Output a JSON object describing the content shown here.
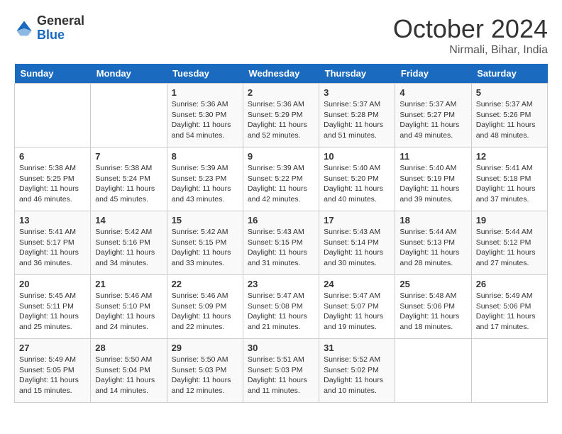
{
  "logo": {
    "general": "General",
    "blue": "Blue"
  },
  "title": "October 2024",
  "location": "Nirmali, Bihar, India",
  "days_header": [
    "Sunday",
    "Monday",
    "Tuesday",
    "Wednesday",
    "Thursday",
    "Friday",
    "Saturday"
  ],
  "weeks": [
    [
      {
        "num": "",
        "sunrise": "",
        "sunset": "",
        "daylight": ""
      },
      {
        "num": "",
        "sunrise": "",
        "sunset": "",
        "daylight": ""
      },
      {
        "num": "1",
        "sunrise": "Sunrise: 5:36 AM",
        "sunset": "Sunset: 5:30 PM",
        "daylight": "Daylight: 11 hours and 54 minutes."
      },
      {
        "num": "2",
        "sunrise": "Sunrise: 5:36 AM",
        "sunset": "Sunset: 5:29 PM",
        "daylight": "Daylight: 11 hours and 52 minutes."
      },
      {
        "num": "3",
        "sunrise": "Sunrise: 5:37 AM",
        "sunset": "Sunset: 5:28 PM",
        "daylight": "Daylight: 11 hours and 51 minutes."
      },
      {
        "num": "4",
        "sunrise": "Sunrise: 5:37 AM",
        "sunset": "Sunset: 5:27 PM",
        "daylight": "Daylight: 11 hours and 49 minutes."
      },
      {
        "num": "5",
        "sunrise": "Sunrise: 5:37 AM",
        "sunset": "Sunset: 5:26 PM",
        "daylight": "Daylight: 11 hours and 48 minutes."
      }
    ],
    [
      {
        "num": "6",
        "sunrise": "Sunrise: 5:38 AM",
        "sunset": "Sunset: 5:25 PM",
        "daylight": "Daylight: 11 hours and 46 minutes."
      },
      {
        "num": "7",
        "sunrise": "Sunrise: 5:38 AM",
        "sunset": "Sunset: 5:24 PM",
        "daylight": "Daylight: 11 hours and 45 minutes."
      },
      {
        "num": "8",
        "sunrise": "Sunrise: 5:39 AM",
        "sunset": "Sunset: 5:23 PM",
        "daylight": "Daylight: 11 hours and 43 minutes."
      },
      {
        "num": "9",
        "sunrise": "Sunrise: 5:39 AM",
        "sunset": "Sunset: 5:22 PM",
        "daylight": "Daylight: 11 hours and 42 minutes."
      },
      {
        "num": "10",
        "sunrise": "Sunrise: 5:40 AM",
        "sunset": "Sunset: 5:20 PM",
        "daylight": "Daylight: 11 hours and 40 minutes."
      },
      {
        "num": "11",
        "sunrise": "Sunrise: 5:40 AM",
        "sunset": "Sunset: 5:19 PM",
        "daylight": "Daylight: 11 hours and 39 minutes."
      },
      {
        "num": "12",
        "sunrise": "Sunrise: 5:41 AM",
        "sunset": "Sunset: 5:18 PM",
        "daylight": "Daylight: 11 hours and 37 minutes."
      }
    ],
    [
      {
        "num": "13",
        "sunrise": "Sunrise: 5:41 AM",
        "sunset": "Sunset: 5:17 PM",
        "daylight": "Daylight: 11 hours and 36 minutes."
      },
      {
        "num": "14",
        "sunrise": "Sunrise: 5:42 AM",
        "sunset": "Sunset: 5:16 PM",
        "daylight": "Daylight: 11 hours and 34 minutes."
      },
      {
        "num": "15",
        "sunrise": "Sunrise: 5:42 AM",
        "sunset": "Sunset: 5:15 PM",
        "daylight": "Daylight: 11 hours and 33 minutes."
      },
      {
        "num": "16",
        "sunrise": "Sunrise: 5:43 AM",
        "sunset": "Sunset: 5:15 PM",
        "daylight": "Daylight: 11 hours and 31 minutes."
      },
      {
        "num": "17",
        "sunrise": "Sunrise: 5:43 AM",
        "sunset": "Sunset: 5:14 PM",
        "daylight": "Daylight: 11 hours and 30 minutes."
      },
      {
        "num": "18",
        "sunrise": "Sunrise: 5:44 AM",
        "sunset": "Sunset: 5:13 PM",
        "daylight": "Daylight: 11 hours and 28 minutes."
      },
      {
        "num": "19",
        "sunrise": "Sunrise: 5:44 AM",
        "sunset": "Sunset: 5:12 PM",
        "daylight": "Daylight: 11 hours and 27 minutes."
      }
    ],
    [
      {
        "num": "20",
        "sunrise": "Sunrise: 5:45 AM",
        "sunset": "Sunset: 5:11 PM",
        "daylight": "Daylight: 11 hours and 25 minutes."
      },
      {
        "num": "21",
        "sunrise": "Sunrise: 5:46 AM",
        "sunset": "Sunset: 5:10 PM",
        "daylight": "Daylight: 11 hours and 24 minutes."
      },
      {
        "num": "22",
        "sunrise": "Sunrise: 5:46 AM",
        "sunset": "Sunset: 5:09 PM",
        "daylight": "Daylight: 11 hours and 22 minutes."
      },
      {
        "num": "23",
        "sunrise": "Sunrise: 5:47 AM",
        "sunset": "Sunset: 5:08 PM",
        "daylight": "Daylight: 11 hours and 21 minutes."
      },
      {
        "num": "24",
        "sunrise": "Sunrise: 5:47 AM",
        "sunset": "Sunset: 5:07 PM",
        "daylight": "Daylight: 11 hours and 19 minutes."
      },
      {
        "num": "25",
        "sunrise": "Sunrise: 5:48 AM",
        "sunset": "Sunset: 5:06 PM",
        "daylight": "Daylight: 11 hours and 18 minutes."
      },
      {
        "num": "26",
        "sunrise": "Sunrise: 5:49 AM",
        "sunset": "Sunset: 5:06 PM",
        "daylight": "Daylight: 11 hours and 17 minutes."
      }
    ],
    [
      {
        "num": "27",
        "sunrise": "Sunrise: 5:49 AM",
        "sunset": "Sunset: 5:05 PM",
        "daylight": "Daylight: 11 hours and 15 minutes."
      },
      {
        "num": "28",
        "sunrise": "Sunrise: 5:50 AM",
        "sunset": "Sunset: 5:04 PM",
        "daylight": "Daylight: 11 hours and 14 minutes."
      },
      {
        "num": "29",
        "sunrise": "Sunrise: 5:50 AM",
        "sunset": "Sunset: 5:03 PM",
        "daylight": "Daylight: 11 hours and 12 minutes."
      },
      {
        "num": "30",
        "sunrise": "Sunrise: 5:51 AM",
        "sunset": "Sunset: 5:03 PM",
        "daylight": "Daylight: 11 hours and 11 minutes."
      },
      {
        "num": "31",
        "sunrise": "Sunrise: 5:52 AM",
        "sunset": "Sunset: 5:02 PM",
        "daylight": "Daylight: 11 hours and 10 minutes."
      },
      {
        "num": "",
        "sunrise": "",
        "sunset": "",
        "daylight": ""
      },
      {
        "num": "",
        "sunrise": "",
        "sunset": "",
        "daylight": ""
      }
    ]
  ]
}
